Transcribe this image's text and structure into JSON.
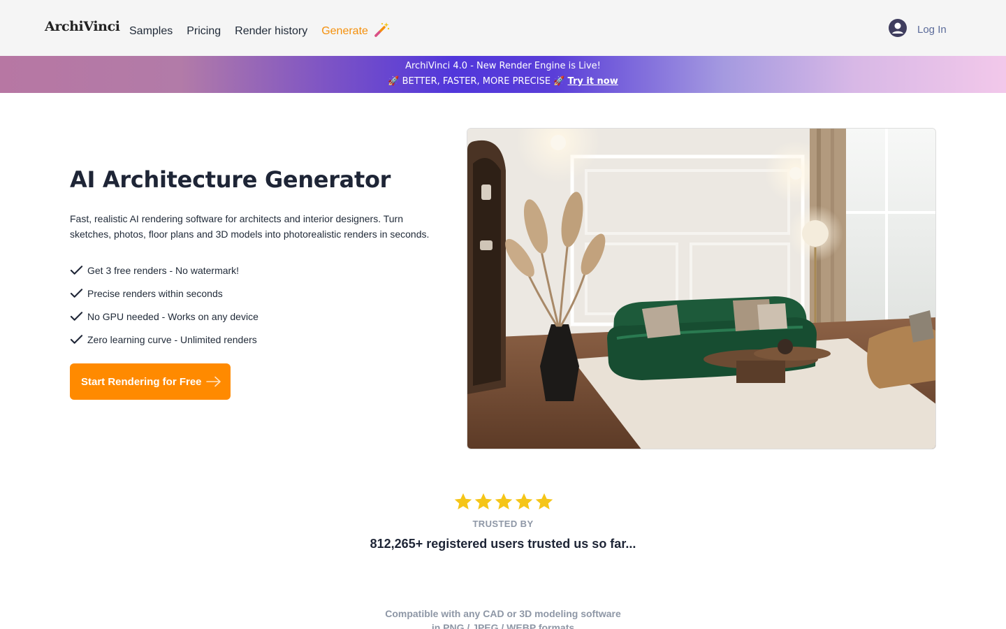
{
  "header": {
    "logo": "ArchiVinci",
    "nav": [
      {
        "label": "Samples"
      },
      {
        "label": "Pricing"
      },
      {
        "label": "Render history"
      },
      {
        "label": "Generate"
      }
    ],
    "login_label": "Log In"
  },
  "banner": {
    "line1": "ArchiVinci 4.0 - New Render Engine is Live!",
    "line2": "🚀 BETTER, FASTER, MORE PRECISE 🚀",
    "link": "Try it now"
  },
  "hero": {
    "title": "AI Architecture Generator",
    "description": "Fast, realistic AI rendering software for architects and interior designers. Turn sketches, photos, floor plans and 3D models into photorealistic renders in seconds.",
    "features": [
      "Get 3 free renders - No watermark!",
      "Precise renders within seconds",
      "No GPU needed - Works on any device",
      "Zero learning curve - Unlimited renders"
    ],
    "cta": "Start Rendering for Free"
  },
  "trust": {
    "rating": 5,
    "label": "TRUSTED BY",
    "count_text": "812,265+ registered users trusted us so far..."
  },
  "compat": {
    "line1": "Compatible with any CAD or 3D modeling software",
    "line2": "in PNG / JPEG / WEBP formats"
  },
  "colors": {
    "accent": "#ff8a00",
    "generate": "#f4900c",
    "star": "#f5c518",
    "sofa": "#1d5a3a"
  },
  "icons": [
    "magic-wand-icon",
    "user-avatar-icon",
    "check-icon",
    "arrow-right-icon",
    "star-icon"
  ]
}
